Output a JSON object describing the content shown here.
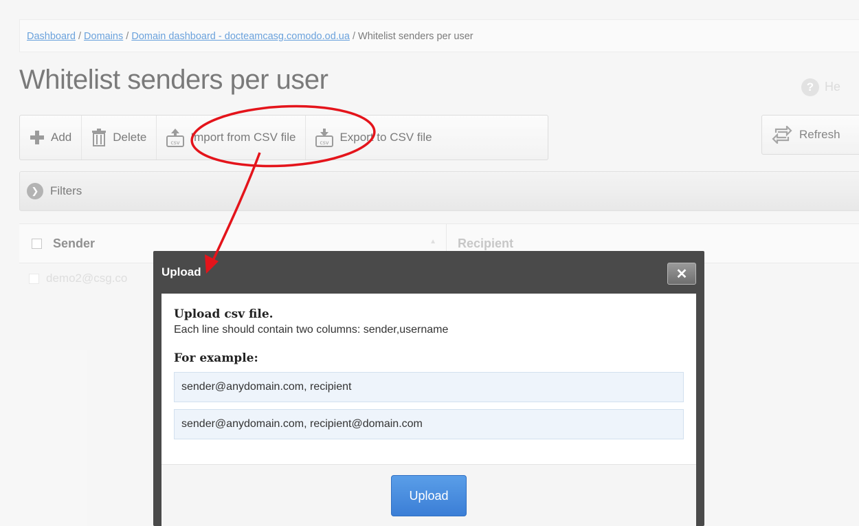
{
  "breadcrumb": {
    "dashboard": "Dashboard",
    "sep": " / ",
    "domains": "Domains",
    "domain_dashboard": "Domain dashboard - docteamcasg.comodo.od.ua",
    "current": "Whitelist senders per user"
  },
  "page": {
    "title": "Whitelist senders per user",
    "help_label": "He"
  },
  "toolbar": {
    "add_label": "Add",
    "delete_label": "Delete",
    "import_label": "Import from CSV file",
    "export_label": "Export to CSV file",
    "refresh_label": "Refresh"
  },
  "filters": {
    "label": "Filters"
  },
  "table": {
    "columns": [
      "Sender",
      "Recipient"
    ],
    "rows": [
      {
        "sender": "demo2@csg.co"
      }
    ]
  },
  "modal": {
    "title": "Upload",
    "close_label": "✕",
    "heading": "Upload csv file.",
    "description": "Each line should contain two columns: sender,username",
    "example_label": "For example:",
    "examples": [
      "sender@anydomain.com, recipient",
      "sender@anydomain.com, recipient@domain.com"
    ],
    "upload_button": "Upload"
  },
  "colors": {
    "link": "#1a6fc9",
    "annotation": "#e4141b",
    "primary_button": "#3b7ed6",
    "modal_frame": "#4a4a4a"
  }
}
